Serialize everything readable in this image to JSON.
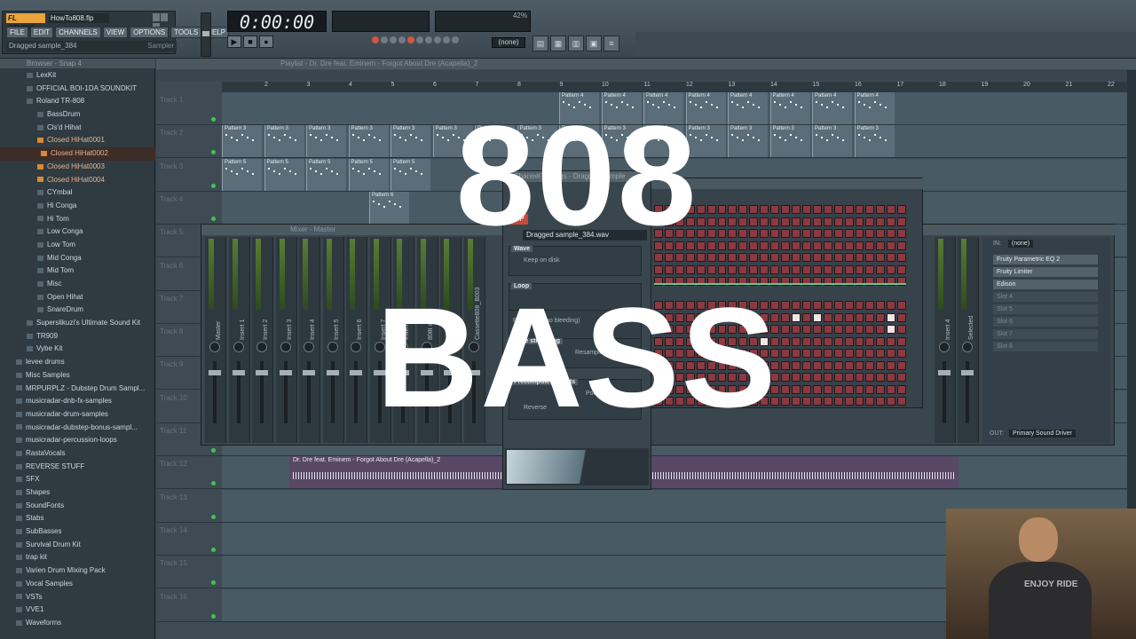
{
  "app": {
    "logo": "FL STUDIO",
    "project_file": "HowTo808.flp"
  },
  "menu": [
    "FILE",
    "EDIT",
    "CHANNELS",
    "VIEW",
    "OPTIONS",
    "TOOLS",
    "HELP"
  ],
  "hint": {
    "text": "Dragged sample_384",
    "right": "Sampler"
  },
  "transport": {
    "time": "0:00:00",
    "play": "▶",
    "stop": "■",
    "record": "●",
    "pattern": "(none)"
  },
  "cpu": {
    "value": "42%"
  },
  "browser": {
    "title": "Browser - Snap 4",
    "items": [
      {
        "label": "LexKit",
        "type": "folder"
      },
      {
        "label": "OFFICIAL BOI-1DA SOUNDKIT",
        "type": "folder"
      },
      {
        "label": "Roland TR-808",
        "type": "folder"
      },
      {
        "label": "BassDrum",
        "type": "folder"
      },
      {
        "label": "Cls'd Hihat",
        "type": "folder"
      },
      {
        "label": "Closed HiHat0001",
        "type": "file"
      },
      {
        "label": "Closed HiHat0002",
        "type": "file",
        "selected": true
      },
      {
        "label": "Closed HiHat0003",
        "type": "file"
      },
      {
        "label": "Closed HiHat0004",
        "type": "file"
      },
      {
        "label": "CYmbal",
        "type": "folder"
      },
      {
        "label": "Hi Conga",
        "type": "folder"
      },
      {
        "label": "Hi Tom",
        "type": "folder"
      },
      {
        "label": "Low Conga",
        "type": "folder"
      },
      {
        "label": "Low Tom",
        "type": "folder"
      },
      {
        "label": "Mid Conga",
        "type": "folder"
      },
      {
        "label": "Mid Tom",
        "type": "folder"
      },
      {
        "label": "Misc",
        "type": "folder"
      },
      {
        "label": "Open Hihat",
        "type": "folder"
      },
      {
        "label": "SnareDrum",
        "type": "folder"
      },
      {
        "label": "Superslikuzi's Ultimate Sound Kit",
        "type": "folder"
      },
      {
        "label": "TR909",
        "type": "folder"
      },
      {
        "label": "Vybe Kit",
        "type": "folder"
      },
      {
        "label": "levee drums",
        "type": "folder"
      },
      {
        "label": "Misc Samples",
        "type": "folder"
      },
      {
        "label": "MRPURPLZ - Dubstep Drum Sampl...",
        "type": "folder"
      },
      {
        "label": "musicradar-dnb-fx-samples",
        "type": "folder"
      },
      {
        "label": "musicradar-drum-samples",
        "type": "folder"
      },
      {
        "label": "musicradar-dubstep-bonus-sampl...",
        "type": "folder"
      },
      {
        "label": "musicradar-percussion-loops",
        "type": "folder"
      },
      {
        "label": "RastaVocals",
        "type": "folder"
      },
      {
        "label": "REVERSE STUFF",
        "type": "folder"
      },
      {
        "label": "SFX",
        "type": "folder"
      },
      {
        "label": "Shapes",
        "type": "folder"
      },
      {
        "label": "SoundFonts",
        "type": "folder"
      },
      {
        "label": "Stabs",
        "type": "folder"
      },
      {
        "label": "SubBasses",
        "type": "folder"
      },
      {
        "label": "Survival Drum Kit",
        "type": "folder"
      },
      {
        "label": "trap kit",
        "type": "folder"
      },
      {
        "label": "Varien Drum Mixing Pack",
        "type": "folder"
      },
      {
        "label": "Vocal Samples",
        "type": "folder"
      },
      {
        "label": "VSTs",
        "type": "folder"
      },
      {
        "label": "VVE1",
        "type": "folder"
      },
      {
        "label": "Waveforms",
        "type": "folder"
      }
    ]
  },
  "playlist": {
    "title": "Playlist - Dr. Dre feat. Eminem - Forgot About Dre (Acapella)_2",
    "ruler": [
      "2",
      "3",
      "4",
      "5",
      "6",
      "7",
      "8",
      "9",
      "10",
      "11",
      "12",
      "13",
      "14",
      "15",
      "16",
      "17",
      "18",
      "19",
      "20",
      "21",
      "22"
    ],
    "tracks": [
      "Track 1",
      "Track 2",
      "Track 3",
      "Track 4",
      "Track 5",
      "Track 6",
      "Track 7",
      "Track 8",
      "Track 9",
      "Track 10",
      "Track 11",
      "Track 12",
      "Track 13",
      "Track 14",
      "Track 15",
      "Track 16"
    ],
    "pattern3": "Pattern 3",
    "pattern4": "Pattern 4",
    "pattern5": "Pattern 5",
    "pattern6": "Pattern 6",
    "audio_clip": "Dr. Dre feat. Eminem - Forgot About Dre (Acapella)_2"
  },
  "mixer": {
    "title": "Mixer - Master",
    "strips": [
      "Master",
      "Insert 1",
      "Insert 2",
      "Insert 3",
      "Insert 4",
      "Insert 5",
      "Insert 6",
      "Insert 7",
      "Insert 8",
      "808t #2",
      "808clap",
      "Cassette808_B003"
    ],
    "strips_right": [
      "Insert 4",
      "Selected"
    ],
    "fx_in_label": "IN:",
    "fx_in": "(none)",
    "fx_slots": [
      "Fruity Parametric EQ 2",
      "Fruity Limiter",
      "Edison"
    ],
    "fx_empty": [
      "Slot 4",
      "Slot 5",
      "Slot 6",
      "Slot 7",
      "Slot 8"
    ],
    "fx_out_label": "OUT:",
    "fx_out": "Primary Sound Driver"
  },
  "channel_settings": {
    "title": "Channel settings - Dragged sample",
    "tab": "SMP",
    "sample": "Dragged sample_384.wav",
    "wave": "Wave",
    "keep_on_disk": "Keep on disk",
    "loop": "Loop",
    "polyphony": "Polyphony (no bleeding)",
    "time_stretching": "Time stretching",
    "resample": "Resample",
    "precomputed": "Precomputed effects",
    "reverse": "Reverse",
    "polarity": "Polarity"
  },
  "overlay": {
    "line1": "808",
    "line2": "BASS"
  },
  "webcam": {
    "shirt": "ENJOY RIDE"
  },
  "colors": {
    "accent": "#d68a34",
    "step_on": "#f0e4e4",
    "step_off": "#8a3a40",
    "title": "#ffffff"
  }
}
